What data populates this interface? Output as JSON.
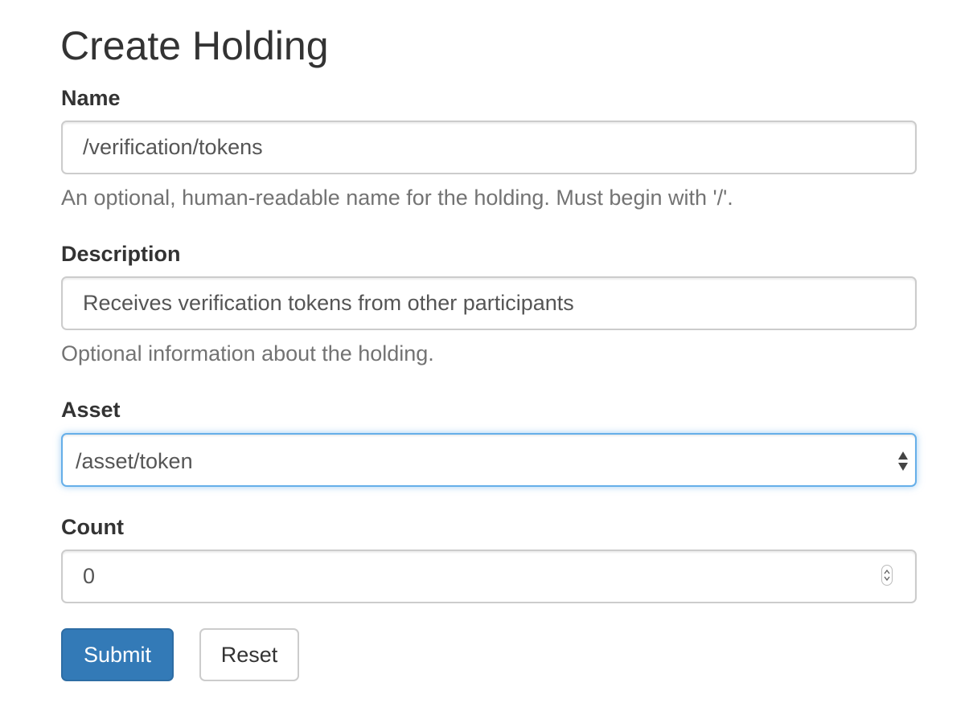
{
  "form": {
    "title": "Create Holding",
    "name": {
      "label": "Name",
      "value": "/verification/tokens",
      "help": "An optional, human-readable name for the holding. Must begin with '/'."
    },
    "description": {
      "label": "Description",
      "value": "Receives verification tokens from other participants",
      "help": "Optional information about the holding."
    },
    "asset": {
      "label": "Asset",
      "selected": "/asset/token"
    },
    "count": {
      "label": "Count",
      "value": "0"
    },
    "buttons": {
      "submit": "Submit",
      "reset": "Reset"
    }
  },
  "colors": {
    "primary": "#337ab7",
    "focus_border": "#66afe9",
    "text": "#333333",
    "help_text": "#737373"
  },
  "icons": {
    "select_arrows": "up-down-arrows-icon",
    "number_stepper": "stepper-icon"
  }
}
